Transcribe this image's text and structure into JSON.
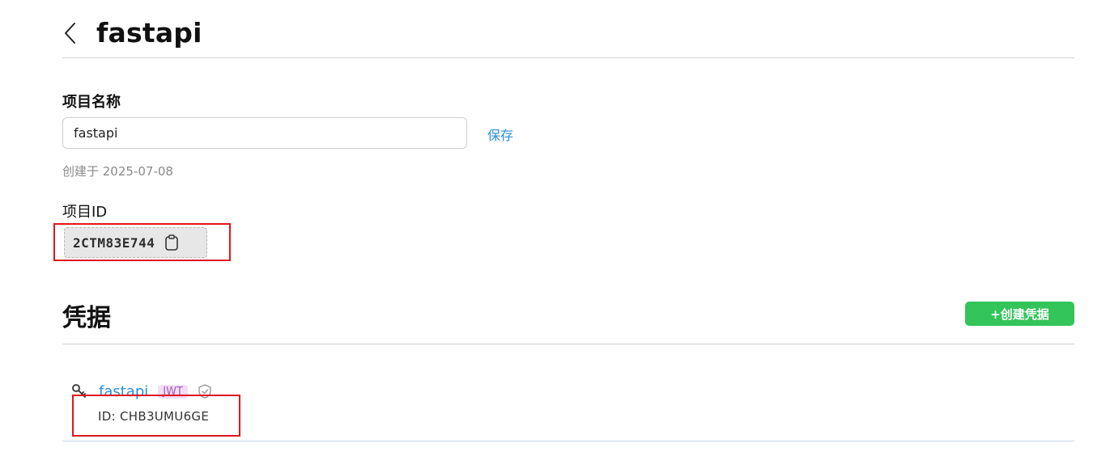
{
  "header": {
    "title": "fastapi"
  },
  "project": {
    "name_label": "项目名称",
    "name_value": "fastapi",
    "save_label": "保存",
    "created_text": "创建于 2025-07-08",
    "id_label": "项目ID",
    "id_value": "2CTM83E744"
  },
  "credentials": {
    "section_title": "凭据",
    "create_button_label": "+创建凭据",
    "items": [
      {
        "name": "fastapi",
        "badge": "JWT",
        "id_text": "ID: CHB3UMU6GE"
      }
    ]
  },
  "colors": {
    "link": "#2a8fd6",
    "create_button": "#33c45a",
    "jwt_badge_bg": "#f2ddf6",
    "jwt_badge_text": "#a25fb8",
    "highlight": "#e0161b"
  },
  "icons": {
    "back": "chevron-left-icon",
    "copy": "clipboard-icon",
    "key": "key-icon",
    "shield": "shield-check-icon"
  }
}
